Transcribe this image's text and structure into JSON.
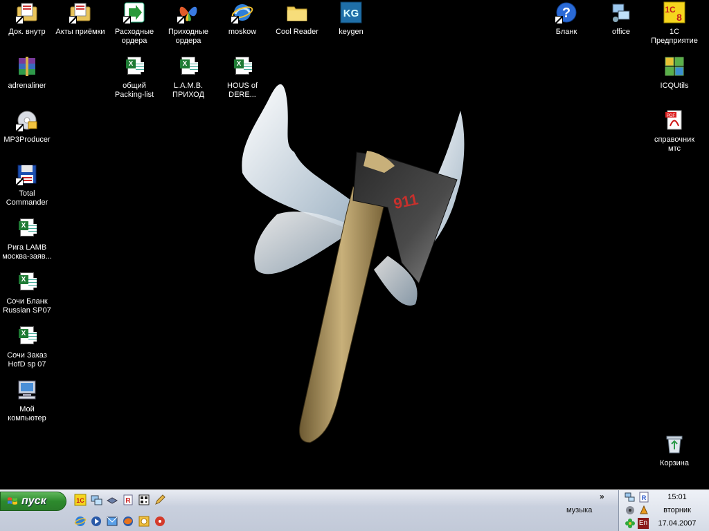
{
  "desktop_icons": {
    "dok_vnutr": "Док. внутр",
    "akty_priemki": "Акты приёмки",
    "rashodnye_ordera": "Расходные\nордера",
    "prihodnye_ordera": "Приходные\nордера",
    "moskow": "moskow",
    "cool_reader": "Cool Reader",
    "keygen": "keygen",
    "blank": "Бланк",
    "office": "office",
    "onec": "1С\nПредприятие",
    "adrenaliner": "adrenaliner",
    "obshchiy_packing": "общий\nPacking-list",
    "lamb_prihod": "L.A.M.B.\nПРИХОД",
    "hous_of_dere": "HOUS of\nDERE...",
    "icqutils": "ICQUtils",
    "mp3producer": "MP3Producer",
    "spravochnik_mts": "справочник\nмтс",
    "total_commander": "Total\nCommander",
    "riga_lamb": "Рига LAMB\nмосква-заяв...",
    "sochi_blank": "Сочи Бланк\nRussian  SP07",
    "sochi_zakaz": "Сочи Заказ\nHofD sp 07",
    "moy_kompyuter": "Мой\nкомпьютер",
    "korzina": "Корзина"
  },
  "wallpaper": {
    "axe_text": "911"
  },
  "taskbar": {
    "start_label": "пуск",
    "toolbar_label": "музыка",
    "chevron": "»",
    "clock": {
      "time": "15:01",
      "day": "вторник",
      "date": "17.04.2007"
    },
    "language": "En",
    "onec_badge": "1С\n8"
  },
  "colors": {
    "desktop": "#000000",
    "start_green": "#2d8a2d",
    "taskbar": "#c9d0de"
  }
}
